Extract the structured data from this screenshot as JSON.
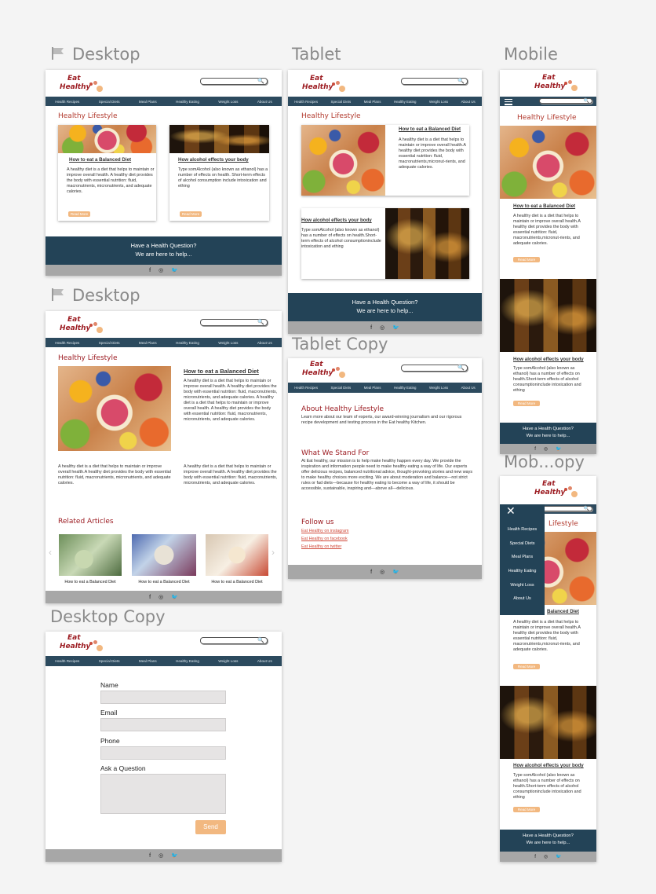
{
  "labels": {
    "desktop1": "Desktop",
    "desktop2": "Desktop",
    "desktop_copy": "Desktop Copy",
    "tablet": "Tablet",
    "tablet_copy": "Tablet Copy",
    "mobile": "Mobile",
    "mobile_copy": "Mob...opy"
  },
  "brand": {
    "line1": "Eat",
    "line2": "Healthy",
    "accent": "#9c1c22",
    "dot_colors": [
      "#c94b3a",
      "#e1876a",
      "#f2b880"
    ]
  },
  "search": {
    "icon": "search-icon"
  },
  "nav": [
    "Health Recipes",
    "Special Diets",
    "Meal Plans",
    "Healthy Eating",
    "Weight Loss",
    "About Us"
  ],
  "colors": {
    "nav_bg": "#2c4a5e",
    "footer_bg": "#234357",
    "heading": "#b23a2e",
    "button": "#f2b880",
    "gray_bar": "#a7a7a7"
  },
  "home": {
    "title": "Healthy Lifestyle",
    "card1": {
      "title": "How to eat a Balanced Diet",
      "text": "A healthy diet is a diet that helps to maintain or improve overall health. A healthy diet provides the body with essential nutrition: fluid, macronutrients, micronutrients, and adequate calories."
    },
    "card2": {
      "title": "How alcohol effects your body",
      "text": "Type somAlcohol (also known as ethanol) has a number of effects on health. Short-term effects of alcohol consumption include intoxication and ething"
    },
    "read_more": "Read More",
    "question1": "Have a Health Question?",
    "question2": "We are here to help..."
  },
  "tablet": {
    "card1_text": "A healthy diet is a diet that helps to maintain or improve overall health.A healthy diet provides the body with essential nutrition: fluid, macronutrients,micronut-rients, and adequate calories.",
    "card2_text": "Type somAlcohol (also known as ethanol) has a number of effects on health.Short-term effects of alcohol consumptioninclude intoxication and ething"
  },
  "article": {
    "title": "How to eat a Balanced Diet",
    "p1": "A healthy diet is a diet that helps to maintain or improve overall health. A healthy diet provides the body with essential nutrition: fluid, macronutrients, micronutrients, and adequate calories. A healthy diet is a diet that helps to maintain or improve overall health. A healthy diet provides the body with essential nutrition: fluid, macronutrients, micronutrients, and adequate calories.",
    "p2": "A healthy diet is a diet that helps to maintain or improve overall health.A healthy diet provides the body with essential nutrition: fluid, macronutrients, micronutrients, and adequate calories.",
    "p3": "A healthy diet is a diet that helps to maintain or improve overall health. A healthy diet provides the body with essential nutrition: fluid, macronutrients, micronutrients, and adequate calories.",
    "related": "Related Articles",
    "related_items": [
      "How to eat a Balanced Diet",
      "How to eat a Balanced Diet",
      "How to eat a Balanced Diet"
    ]
  },
  "form": {
    "name": "Name",
    "email": "Email",
    "phone": "Phone",
    "question": "Ask a Question",
    "send": "Send"
  },
  "about": {
    "title": "About Healthy Lifestyle",
    "text": "Learn more about our team of experts, our award-winning journalism and our rigorous recipe development and testing process in the Eat healthy Kitchen.",
    "stand_title": "What We Stand For",
    "stand_text": "At Eat healthy, our mission is to help make healthy happen every day. We provide the inspiration and information people need to make healthy eating a way of life. Our experts offer delicious recipes, balanced nutritional advice, thought-provoking stories and new ways to make healthy choices more exciting. We are about moderation and balance—not strict rules or fad diets—because for healthy eating to become a way of life, it should be accessible, sustainable, inspiring and—above all—delicious.",
    "follow": "Follow us",
    "links": [
      "Eat Healthy on instagram",
      "Eat Healthy on facebook",
      "Eat Healthy on twitter"
    ]
  },
  "mobile": {
    "card1_text": "A healthy diet is a diet that helps to maintain or improve overall health.A healthy diet provides the body with essential nutrition: fluid, macronutrients,micronut-rients, and adequate calories.",
    "card2_text": "Type somAlcohol (also known as ethanol) has a number of effects on health.Short-term effects of alcohol consumptioninclude intoxication and ething",
    "partial_title": "Lifestyle",
    "partial_card": "Balanced Diet"
  },
  "social": {
    "facebook": "f",
    "instagram": "◎",
    "twitter": "🐦"
  }
}
